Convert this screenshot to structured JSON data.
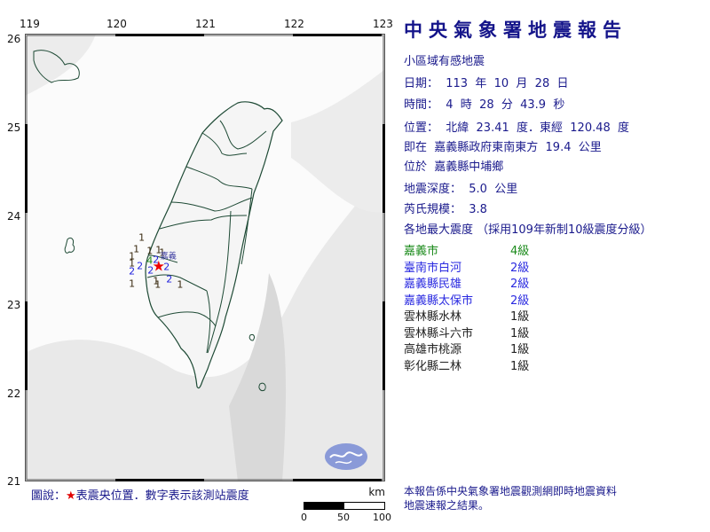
{
  "map": {
    "lon_ticks": [
      "119",
      "120",
      "121",
      "122",
      "123"
    ],
    "lat_ticks": [
      "26",
      "25",
      "24",
      "23",
      "22",
      "21"
    ],
    "epicenter_label": "嘉義",
    "stations": [
      {
        "intensity": "2",
        "color": "#2222dd",
        "lon": 120.45,
        "lat": 23.44
      },
      {
        "intensity": "2",
        "color": "#2222dd",
        "lon": 120.27,
        "lat": 23.37
      },
      {
        "intensity": "2",
        "color": "#2222dd",
        "lon": 120.18,
        "lat": 23.31
      },
      {
        "intensity": "2",
        "color": "#2222dd",
        "lon": 120.39,
        "lat": 23.32
      },
      {
        "intensity": "2",
        "color": "#2222dd",
        "lon": 120.57,
        "lat": 23.36
      },
      {
        "intensity": "2",
        "color": "#2222dd",
        "lon": 120.6,
        "lat": 23.22
      },
      {
        "intensity": "4",
        "color": "#1a8a1a",
        "lon": 120.38,
        "lat": 23.43
      },
      {
        "intensity": "1",
        "color": "#3a2a10",
        "lon": 120.29,
        "lat": 23.69
      },
      {
        "intensity": "1",
        "color": "#3a2a10",
        "lon": 120.23,
        "lat": 23.56
      },
      {
        "intensity": "1",
        "color": "#3a2a10",
        "lon": 120.38,
        "lat": 23.54
      },
      {
        "intensity": "1",
        "color": "#3a2a10",
        "lon": 120.48,
        "lat": 23.55
      },
      {
        "intensity": "1",
        "color": "#3a2a10",
        "lon": 120.52,
        "lat": 23.52
      },
      {
        "intensity": "1",
        "color": "#3a2a10",
        "lon": 120.18,
        "lat": 23.48
      },
      {
        "intensity": "1",
        "color": "#3a2a10",
        "lon": 120.18,
        "lat": 23.4
      },
      {
        "intensity": "1",
        "color": "#3a2a10",
        "lon": 120.18,
        "lat": 23.17
      },
      {
        "intensity": "1",
        "color": "#3a2a10",
        "lon": 120.45,
        "lat": 23.2
      },
      {
        "intensity": "1",
        "color": "#3a2a10",
        "lon": 120.47,
        "lat": 23.16
      },
      {
        "intensity": "1",
        "color": "#3a2a10",
        "lon": 120.72,
        "lat": 23.16
      }
    ],
    "epicenter": {
      "lon": 120.48,
      "lat": 23.41
    }
  },
  "report": {
    "title": "中央氣象署地震報告",
    "subtitle": "小區域有感地震",
    "date_line": "日期：  113  年  10  月  28  日",
    "time_line": "時間：  4  時  28  分  43.9  秒",
    "location_line": "位置：  北緯  23.41  度．東經  120.48  度",
    "relative_line": "即在  嘉義縣政府東南東方  19.4  公里",
    "township_line": "位於  嘉義縣中埔鄉",
    "depth_line": "地震深度：  5.0  公里",
    "magnitude_line": "芮氏規模：  3.8",
    "intensity_header": "各地最大震度 （採用109年新制10級震度分級）",
    "intensities": [
      {
        "place": "嘉義市",
        "level": "4級",
        "color": "#1a8a1a"
      },
      {
        "place": "臺南市白河",
        "level": "2級",
        "color": "#2a2ae0"
      },
      {
        "place": "嘉義縣民雄",
        "level": "2級",
        "color": "#2a2ae0"
      },
      {
        "place": "嘉義縣太保市",
        "level": "2級",
        "color": "#2a2ae0"
      },
      {
        "place": "雲林縣水林",
        "level": "1級",
        "color": "#222222"
      },
      {
        "place": "雲林縣斗六市",
        "level": "1級",
        "color": "#222222"
      },
      {
        "place": "高雄市桃源",
        "level": "1級",
        "color": "#222222"
      },
      {
        "place": "彰化縣二林",
        "level": "1級",
        "color": "#222222"
      }
    ],
    "footer_line1": "本報告係中央氣象署地震觀測網即時地震資料",
    "footer_line2": "地震速報之結果。"
  },
  "legend": {
    "prefix": "圖說：",
    "star": "★",
    "text": "表震央位置．數字表示該測站震度"
  },
  "scale": {
    "unit": "km",
    "labels": [
      "0",
      "50",
      "100"
    ]
  }
}
